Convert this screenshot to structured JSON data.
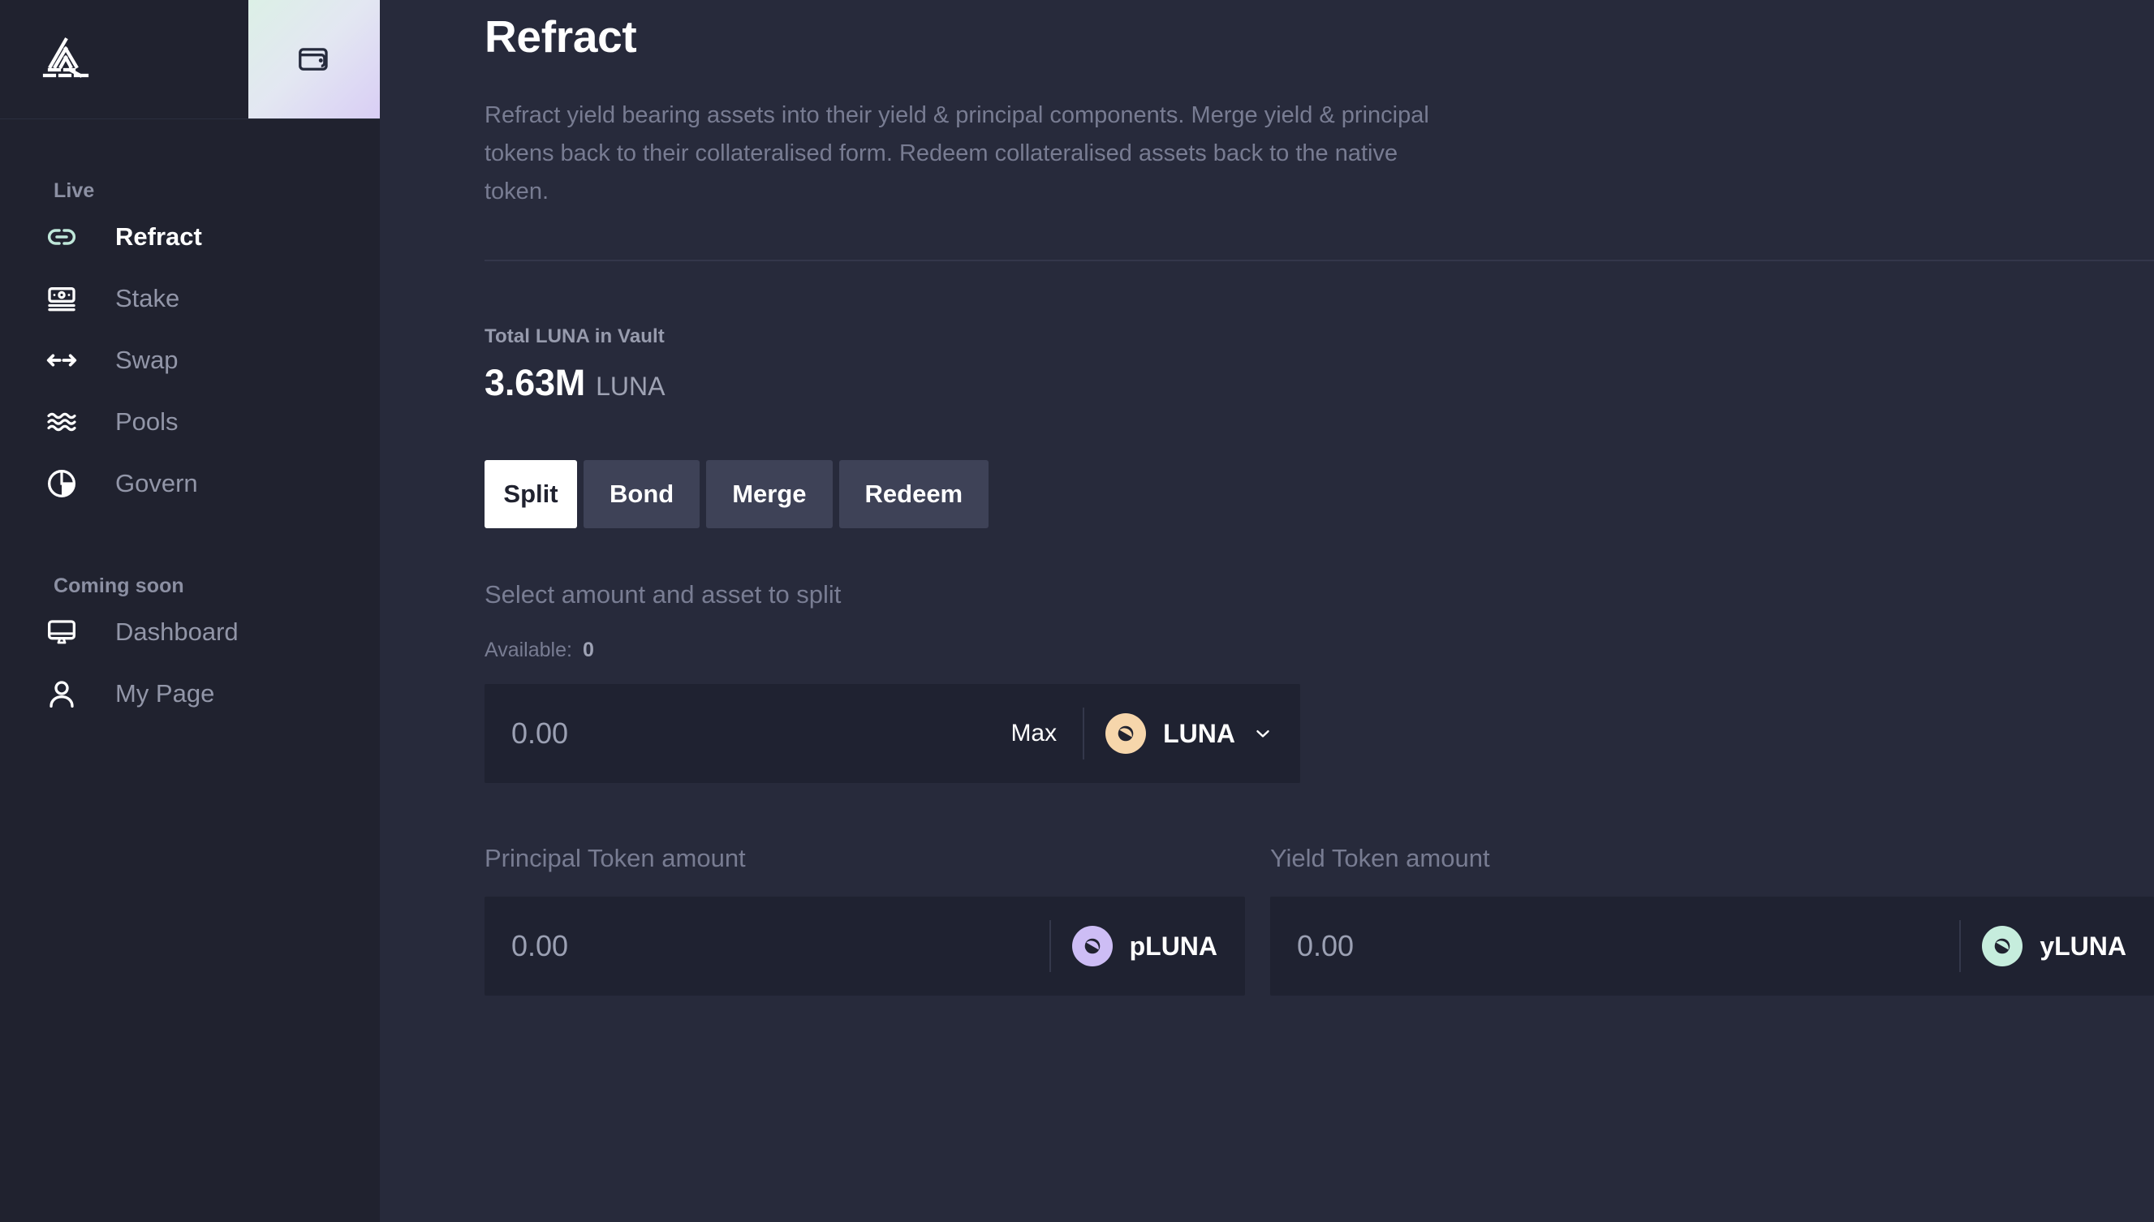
{
  "sidebar": {
    "logo_name": "prism-logo",
    "wallet_button_label": "wallet-icon",
    "groups": [
      {
        "label": "Live",
        "items": [
          {
            "label": "Refract",
            "icon": "link-icon",
            "active": true
          },
          {
            "label": "Stake",
            "icon": "banknote-icon",
            "active": false
          },
          {
            "label": "Swap",
            "icon": "swap-arrows-icon",
            "active": false
          },
          {
            "label": "Pools",
            "icon": "waves-icon",
            "active": false
          },
          {
            "label": "Govern",
            "icon": "pie-chart-icon",
            "active": false
          }
        ]
      },
      {
        "label": "Coming soon",
        "items": [
          {
            "label": "Dashboard",
            "icon": "monitor-icon",
            "active": false
          },
          {
            "label": "My Page",
            "icon": "user-icon",
            "active": false
          }
        ]
      }
    ]
  },
  "main": {
    "title": "Refract",
    "description": "Refract yield bearing assets into their yield & principal components. Merge yield & principal tokens back to their collateralised form. Redeem collateralised assets back to the native token.",
    "stat": {
      "label": "Total LUNA in Vault",
      "value": "3.63M",
      "unit": "LUNA"
    },
    "tabs": [
      {
        "label": "Split",
        "active": true
      },
      {
        "label": "Bond",
        "active": false
      },
      {
        "label": "Merge",
        "active": false
      },
      {
        "label": "Redeem",
        "active": false
      }
    ],
    "form": {
      "section_label": "Select amount and asset to split",
      "available_label": "Available:",
      "available_value": "0",
      "amount_value": "0.00",
      "max_label": "Max",
      "selected_token": "LUNA",
      "principal": {
        "label": "Principal Token amount",
        "value": "0.00",
        "token": "pLUNA"
      },
      "yield": {
        "label": "Yield Token amount",
        "value": "0.00",
        "token": "yLUNA"
      }
    }
  },
  "colors": {
    "sidebar_bg": "#20222F",
    "main_bg": "#272A3B",
    "input_bg": "#1F2231",
    "accent_mint": "#C6EDDD",
    "accent_lavender": "#CDBDF5",
    "accent_peach": "#F6D6AB",
    "active_tab_bg": "#FFFFFF",
    "tab_bg": "#3E4257"
  }
}
